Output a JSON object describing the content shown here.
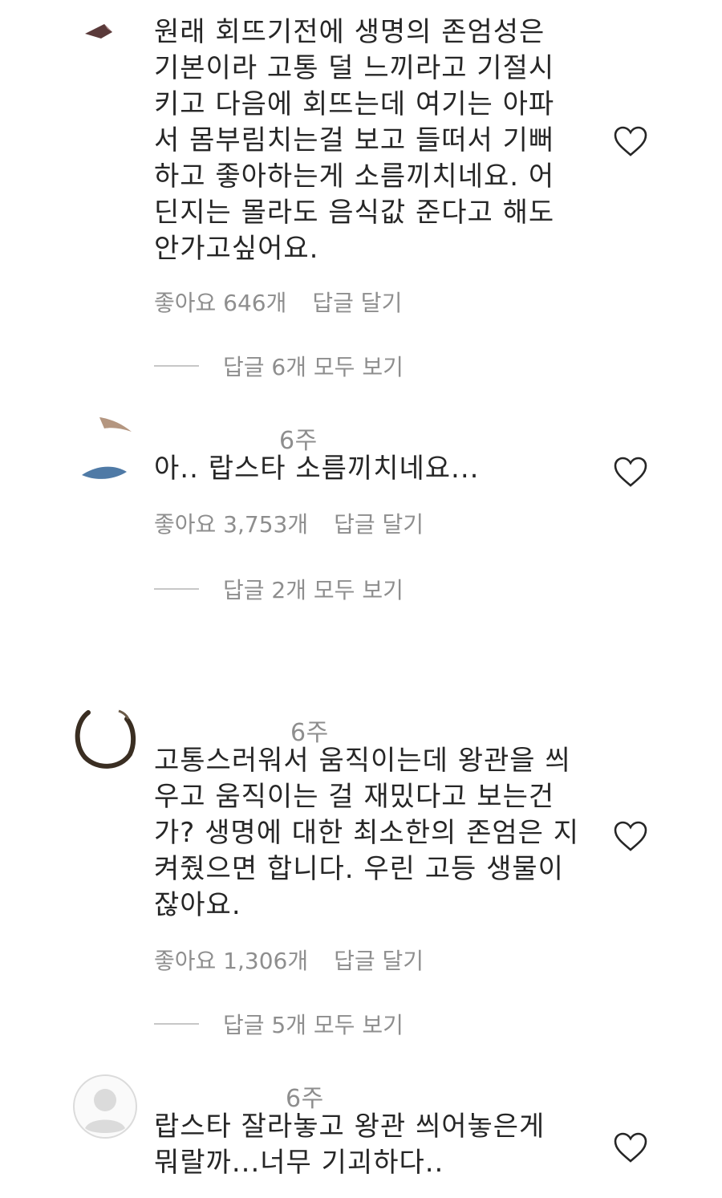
{
  "comments": [
    {
      "username": "",
      "time": "",
      "text": "원래 회뜨기전에 생명의 존엄성은\n기본이라 고통 덜 느끼라고 기절시\n키고 다음에 회뜨는데 여기는 아파\n서 몸부림치는걸 보고 들떠서 기뻐\n하고 좋아하는게 소름끼치네요. 어\n딘지는 몰라도 음식값 준다고 해도\n안가고싶어요.",
      "likes": "좋아요 646개",
      "reply_label": "답글 달기",
      "view_replies": "답글 6개 모두 보기"
    },
    {
      "username": "",
      "time": "6주",
      "text": "아.. 랍스타 소름끼치네요...",
      "likes": "좋아요 3,753개",
      "reply_label": "답글 달기",
      "view_replies": "답글 2개 모두 보기"
    },
    {
      "username": "",
      "time": "6주",
      "text": "고통스러워서 움직이는데 왕관을 씌\n우고 움직이는 걸 재밌다고 보는건\n가? 생명에 대한 최소한의 존엄은 지\n켜줬으면 합니다. 우린 고등 생물이\n잖아요.",
      "likes": "좋아요 1,306개",
      "reply_label": "답글 달기",
      "view_replies": "답글 5개 모두 보기"
    },
    {
      "username": "",
      "time": "6주",
      "text": "랍스타 잘라놓고 왕관 씌어놓은게\n뭐랄까...너무 기괴하다..",
      "likes": "",
      "reply_label": "",
      "view_replies": ""
    }
  ],
  "icons": {
    "like": "heart-outline-icon",
    "avatar_default": "default-avatar-icon"
  },
  "colors": {
    "text": "#262626",
    "secondary": "#8e8e8e",
    "divider": "#c7c7c7"
  }
}
